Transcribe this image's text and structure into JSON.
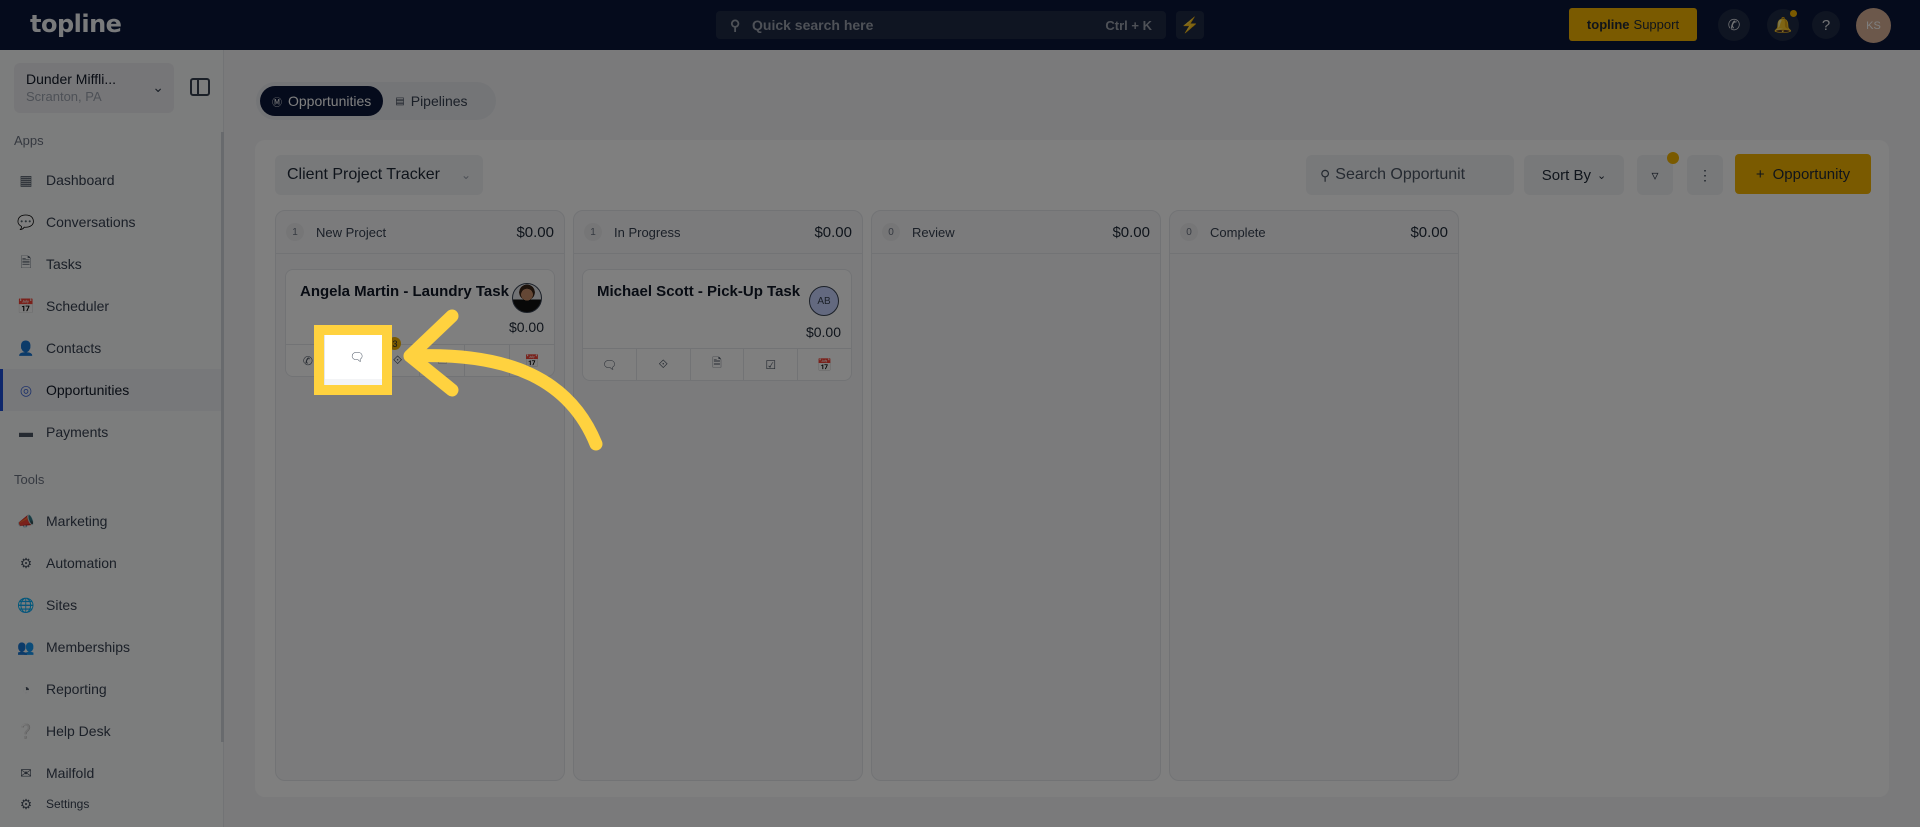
{
  "topbar": {
    "logo": "topline",
    "search_placeholder": "Quick search here",
    "search_shortcut": "Ctrl + K",
    "support_brand": "topline",
    "support_label": "Support",
    "help_label": "?",
    "user_initials": "KS"
  },
  "sidebar": {
    "location_name": "Dunder Miffli...",
    "location_city": "Scranton, PA",
    "apps_label": "Apps",
    "apps": [
      {
        "label": "Dashboard",
        "icon": "dashboard-icon"
      },
      {
        "label": "Conversations",
        "icon": "chat-bubbles-icon"
      },
      {
        "label": "Tasks",
        "icon": "task-doc-icon"
      },
      {
        "label": "Scheduler",
        "icon": "calendar-icon"
      },
      {
        "label": "Contacts",
        "icon": "person-icon"
      },
      {
        "label": "Opportunities",
        "icon": "target-icon",
        "active": true
      },
      {
        "label": "Payments",
        "icon": "credit-card-icon"
      }
    ],
    "tools_label": "Tools",
    "tools": [
      {
        "label": "Marketing",
        "icon": "megaphone-icon"
      },
      {
        "label": "Automation",
        "icon": "gears-icon"
      },
      {
        "label": "Sites",
        "icon": "globe-cursor-icon"
      },
      {
        "label": "Memberships",
        "icon": "users-plus-icon"
      },
      {
        "label": "Reporting",
        "icon": "pie-chart-icon"
      },
      {
        "label": "Help Desk",
        "icon": "question-circle-icon"
      },
      {
        "label": "Mailfold",
        "icon": "mail-stack-icon"
      }
    ],
    "settings_label": "Settings"
  },
  "main": {
    "tabs": [
      {
        "label": "Opportunities",
        "active": true
      },
      {
        "label": "Pipelines",
        "active": false
      }
    ],
    "pipeline_select": "Client Project Tracker",
    "search_placeholder": "Search Opportunit",
    "sort_label": "Sort By",
    "add_label": "Opportunity",
    "columns": [
      {
        "count": "1",
        "name": "New Project",
        "total": "$0.00",
        "cards": [
          {
            "title": "Angela Martin - Laundry Task",
            "value": "$0.00",
            "avatar": "photo",
            "tag_badge": "3"
          }
        ]
      },
      {
        "count": "1",
        "name": "In Progress",
        "total": "$0.00",
        "cards": [
          {
            "title": "Michael Scott - Pick-Up Task",
            "value": "$0.00",
            "avatar_initials": "AB"
          }
        ]
      },
      {
        "count": "0",
        "name": "Review",
        "total": "$0.00",
        "cards": []
      },
      {
        "count": "0",
        "name": "Complete",
        "total": "$0.00",
        "cards": []
      }
    ]
  },
  "colors": {
    "brand_navy": "#0b1739",
    "accent_yellow": "#f5b400",
    "highlight_yellow": "#ffd23f",
    "active_nav_blue": "#1d4ed8"
  }
}
